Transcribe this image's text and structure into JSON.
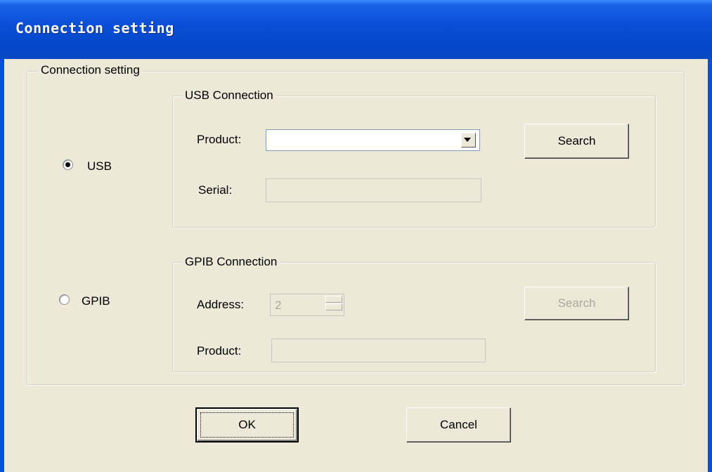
{
  "window": {
    "title": "Connection setting"
  },
  "main_group": {
    "legend": "Connection setting"
  },
  "radios": {
    "usb": {
      "label": "USB",
      "checked": true
    },
    "gpib": {
      "label": "GPIB",
      "checked": false
    }
  },
  "usb": {
    "legend": "USB Connection",
    "product_label": "Product:",
    "product_value": "",
    "serial_label": "Serial:",
    "serial_value": "",
    "search_label": "Search"
  },
  "gpib": {
    "legend": "GPIB Connection",
    "address_label": "Address:",
    "address_value": "2",
    "product_label": "Product:",
    "product_value": "",
    "search_label": "Search"
  },
  "buttons": {
    "ok": "OK",
    "cancel": "Cancel"
  }
}
